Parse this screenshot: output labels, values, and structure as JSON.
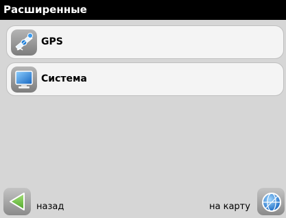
{
  "window": {
    "title": "Расширенные"
  },
  "menu": {
    "items": [
      {
        "label": "GPS",
        "icon": "satellite-icon"
      },
      {
        "label": "Система",
        "icon": "monitor-icon"
      }
    ]
  },
  "bottom_bar": {
    "back_label": "назад",
    "map_label": "на карту"
  },
  "colors": {
    "background": "#d6d6d6",
    "titlebar": "#000000",
    "item_bg": "#f4f4f4",
    "icon_frame": "#9a9a9a",
    "accent_blue": "#1e7fd8",
    "back_arrow_green": "#6cc24a"
  }
}
